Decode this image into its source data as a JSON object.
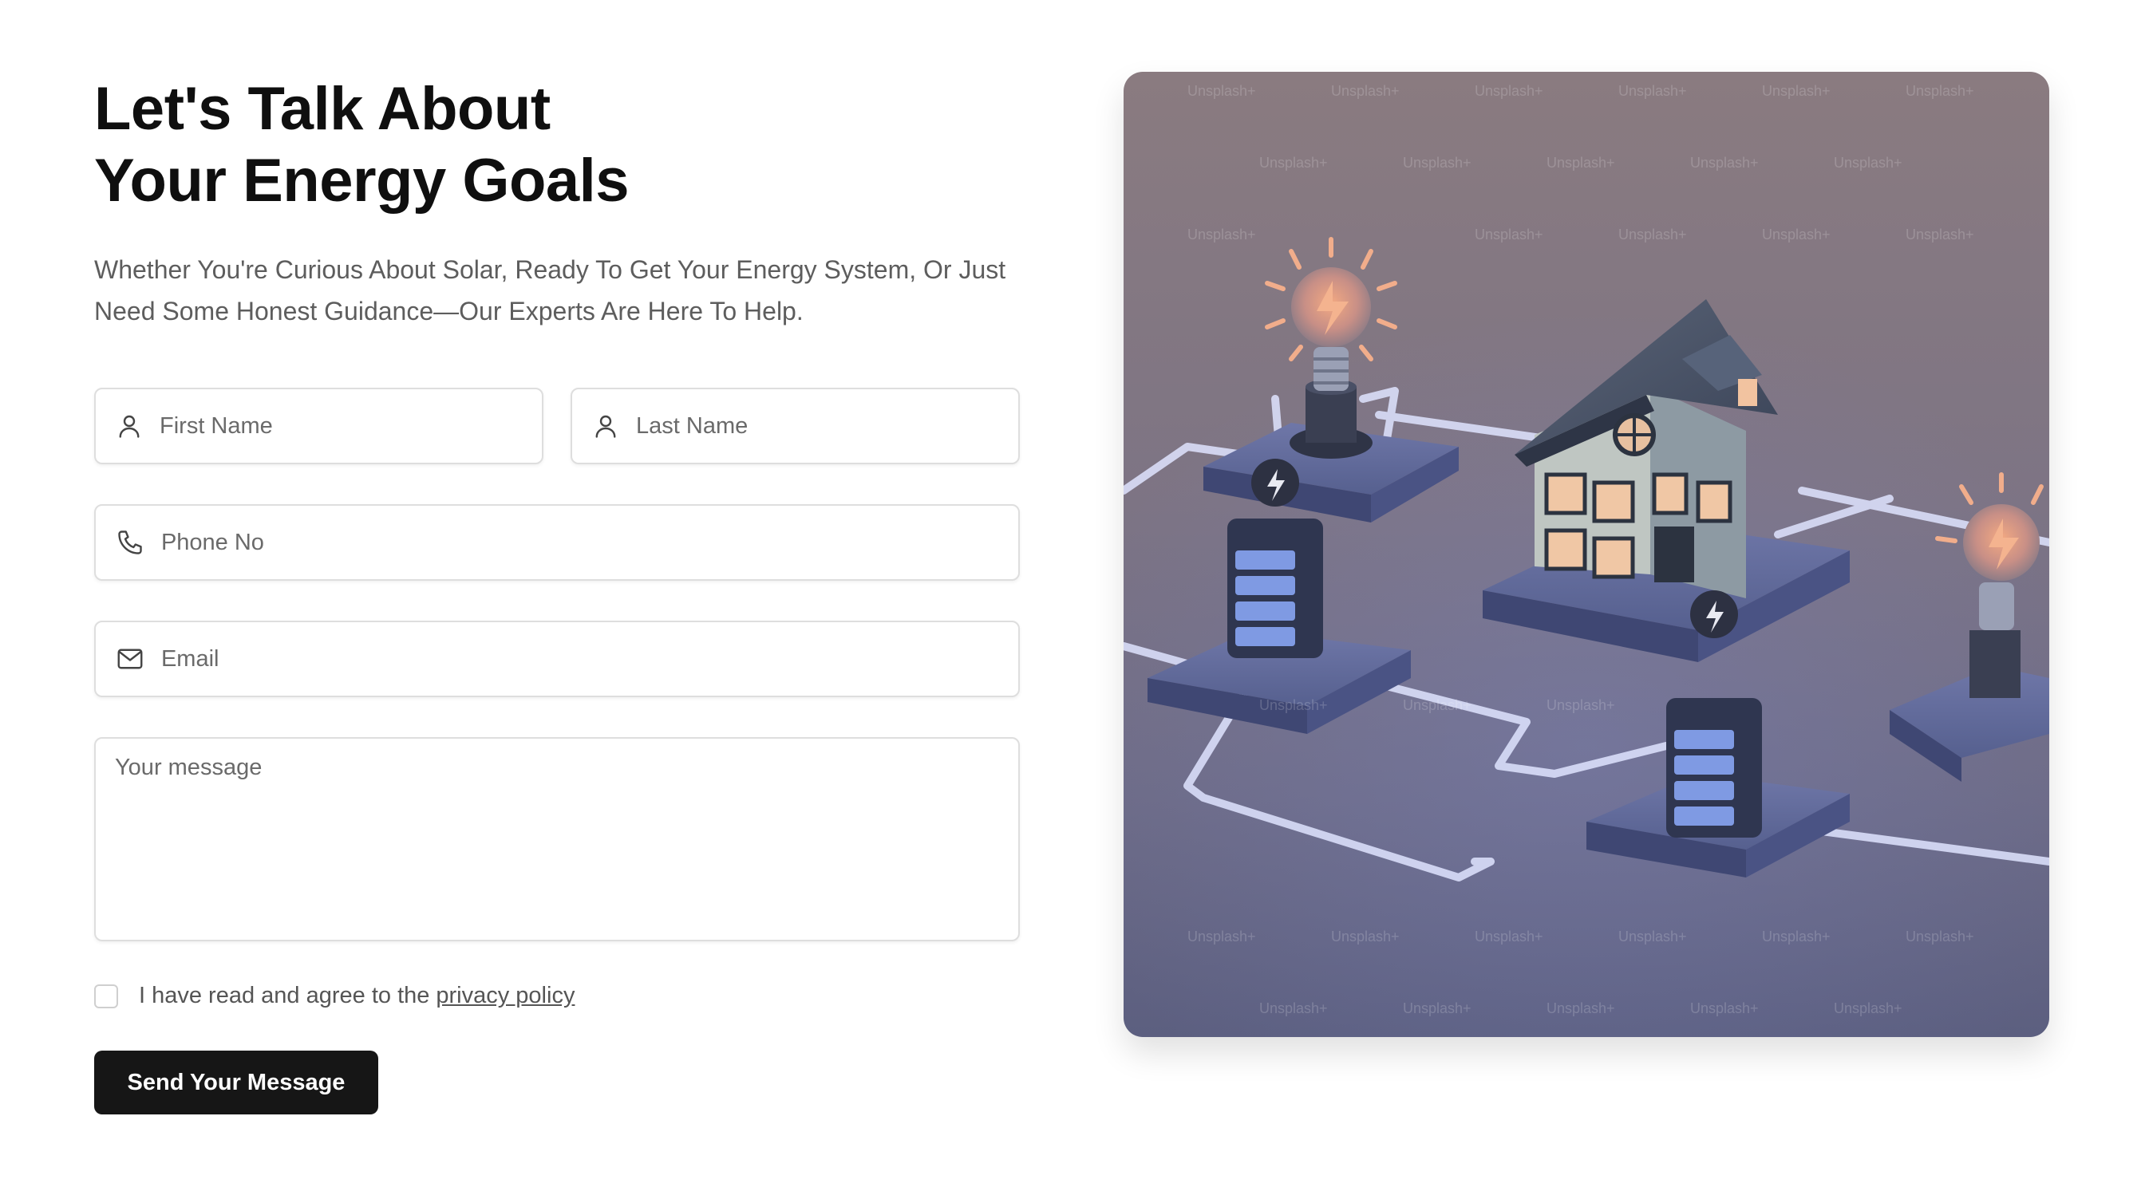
{
  "heading": {
    "line1": "Let's Talk About",
    "line2": "Your Energy Goals"
  },
  "subtitle": "Whether You're Curious About Solar, Ready To Get Your Energy System, Or Just Need Some Honest Guidance—Our Experts Are Here To Help.",
  "form": {
    "first_name_placeholder": "First Name",
    "last_name_placeholder": "Last Name",
    "phone_placeholder": "Phone No",
    "email_placeholder": "Email",
    "message_placeholder": "Your message",
    "consent_text": "I have read and agree to the",
    "consent_link": "privacy policy",
    "consent_checked": false,
    "submit_label": "Send Your Message"
  },
  "icons": {
    "first_name": "user-icon",
    "last_name": "user-icon",
    "phone": "phone-icon",
    "email": "mail-icon"
  },
  "hero_image": {
    "description_icon": "energy-house-illustration",
    "watermark": "Unsplash+"
  }
}
